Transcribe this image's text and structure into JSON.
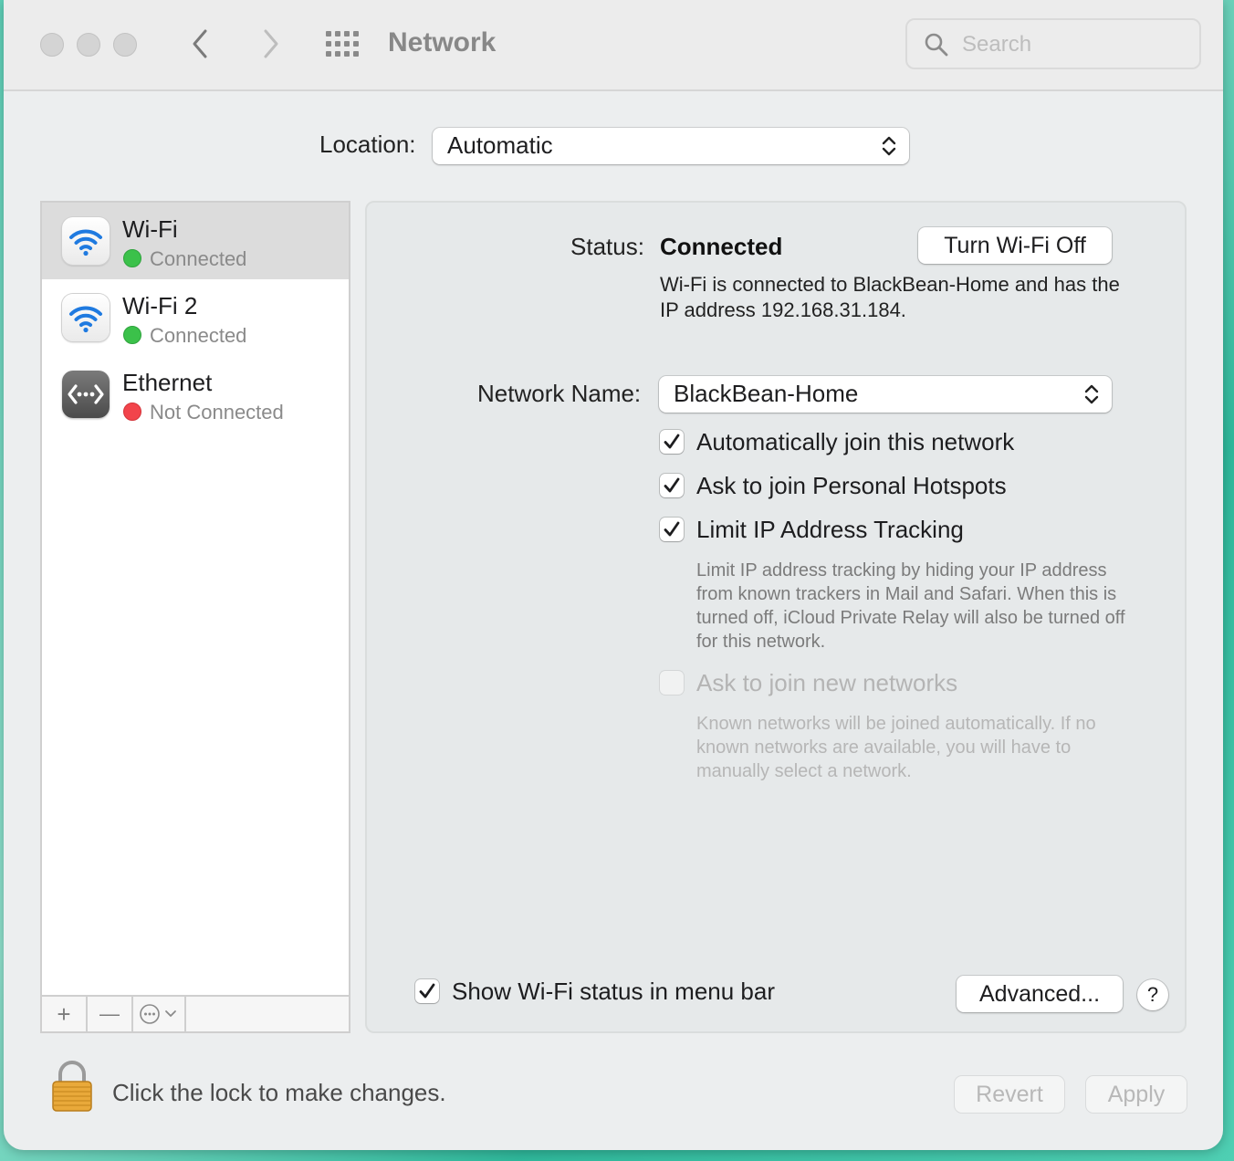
{
  "window": {
    "title": "Network",
    "search_placeholder": "Search"
  },
  "location": {
    "label": "Location:",
    "value": "Automatic"
  },
  "services": [
    {
      "name": "Wi-Fi",
      "status": "Connected",
      "status_color": "#3bc14a",
      "icon": "wifi-icon",
      "selected": true
    },
    {
      "name": "Wi-Fi 2",
      "status": "Connected",
      "status_color": "#3bc14a",
      "icon": "wifi-icon",
      "selected": false
    },
    {
      "name": "Ethernet",
      "status": "Not Connected",
      "status_color": "#f2444b",
      "icon": "ethernet-icon",
      "selected": false
    }
  ],
  "sidebar_toolbar": {
    "add": "+",
    "remove": "—"
  },
  "detail": {
    "status_label": "Status:",
    "status_value": "Connected",
    "toggle_button": "Turn Wi-Fi Off",
    "status_description": "Wi-Fi is connected to BlackBean-Home and has the IP address 192.168.31.184.",
    "network_name_label": "Network Name:",
    "network_name_value": "BlackBean-Home",
    "options": [
      {
        "label": "Automatically join this network",
        "checked": true,
        "enabled": true
      },
      {
        "label": "Ask to join Personal Hotspots",
        "checked": true,
        "enabled": true
      },
      {
        "label": "Limit IP Address Tracking",
        "checked": true,
        "enabled": true
      },
      {
        "label": "Ask to join new networks",
        "checked": false,
        "enabled": false
      }
    ],
    "limit_ip_help": "Limit IP address tracking by hiding your IP address from known trackers in Mail and Safari. When this is turned off, iCloud Private Relay will also be turned off for this network.",
    "new_networks_help": "Known networks will be joined automatically. If no known networks are available, you will have to manually select a network.",
    "show_status_label": "Show Wi-Fi status in menu bar",
    "show_status_checked": true,
    "advanced_button": "Advanced...",
    "help_button": "?"
  },
  "footer": {
    "lock_text": "Click the lock to make changes.",
    "revert": "Revert",
    "apply": "Apply"
  },
  "colors": {
    "accent_blue": "#1f7ae0",
    "connected_green": "#3bc14a",
    "disconnected_red": "#f2444b",
    "lock_gold": "#e9a93a"
  }
}
